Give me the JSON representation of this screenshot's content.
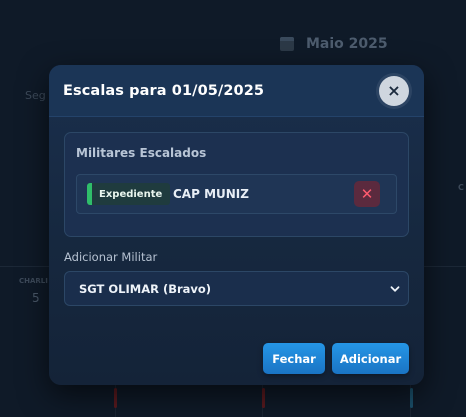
{
  "background": {
    "month_label": "Maio 2025",
    "weekday_label": "Seg",
    "right_col_label": "C",
    "cell_label": "CHARLI",
    "cell_number": "5"
  },
  "modal": {
    "title": "Escalas para 01/05/2025",
    "close_icon": "×",
    "assigned_section": {
      "title": "Militares Escalados",
      "entries": [
        {
          "badge": "Expediente",
          "badge_color": "#2fbe6a",
          "name": "CAP MUNIZ"
        }
      ]
    },
    "add_section": {
      "label": "Adicionar Militar",
      "selected_value": "SGT OLIMAR (Bravo)"
    },
    "buttons": {
      "close_label": "Fechar",
      "add_label": "Adicionar"
    }
  },
  "colors": {
    "accent": "#2596e6",
    "badge_green": "#2fbe6a",
    "remove_red": "#ff5a6e"
  }
}
